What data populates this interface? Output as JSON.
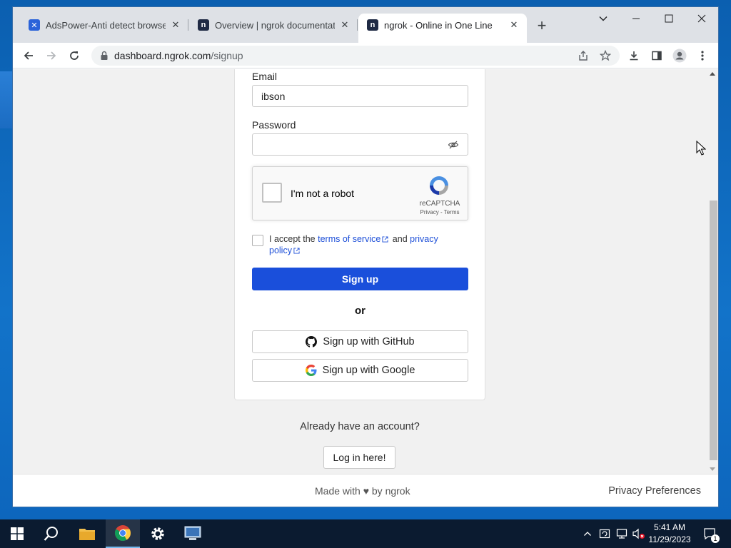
{
  "browser": {
    "tabs": [
      {
        "title": "AdsPower-Anti detect browser f",
        "state": "inactive",
        "favicon_color": "#2b63d9"
      },
      {
        "title": "Overview | ngrok documentatio",
        "state": "inactive",
        "favicon_color": "#1f2a44"
      },
      {
        "title": "ngrok - Online in One Line",
        "state": "active",
        "favicon_color": "#1f2a44"
      }
    ],
    "url_host": "dashboard.ngrok.com",
    "url_path": "/signup"
  },
  "form": {
    "email_label": "Email",
    "email_value": "ibson",
    "password_label": "Password",
    "password_value": "",
    "recaptcha": {
      "label": "I'm not a robot",
      "brand": "reCAPTCHA",
      "links": "Privacy - Terms"
    },
    "terms": {
      "prefix": "I accept the ",
      "tos_link": "terms of service",
      "middle": " and ",
      "privacy_link": "privacy policy"
    },
    "signup_button": "Sign up",
    "or_text": "or",
    "github_button": "Sign up with GitHub",
    "google_button": "Sign up with Google"
  },
  "below_card": {
    "have_account": "Already have an account?",
    "login_button": "Log in here!"
  },
  "footer": {
    "made_with": "Made with ♥ by ngrok",
    "privacy_prefs": "Privacy Preferences"
  },
  "taskbar": {
    "time": "5:41 AM",
    "date": "11/29/2023",
    "notification_count": "1"
  },
  "colors": {
    "primary_button": "#1a4fdb",
    "link": "#1d4fd8",
    "taskbar": "#0b1b30"
  }
}
